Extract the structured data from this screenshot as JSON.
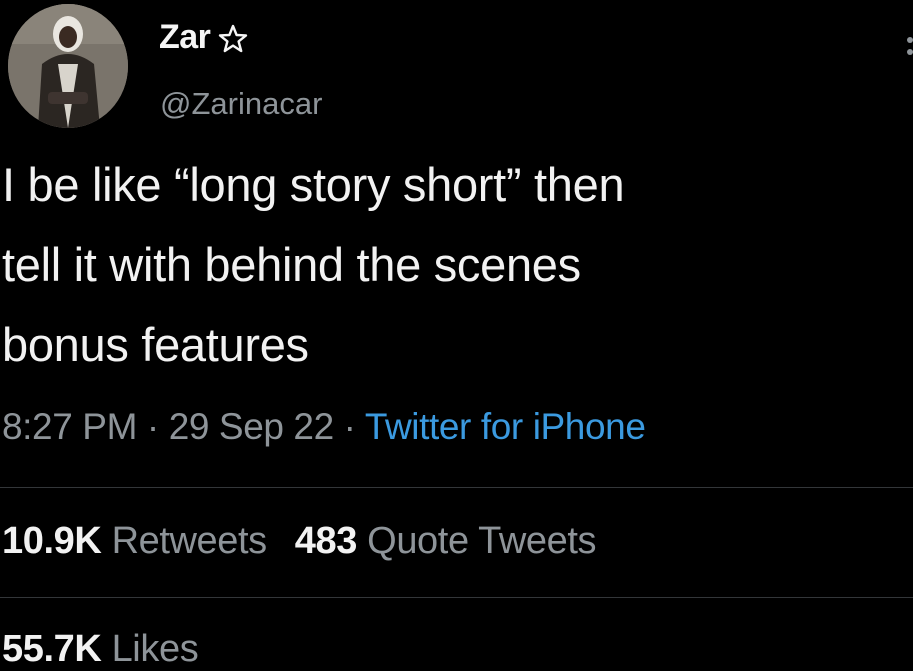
{
  "user": {
    "display_name": "Zar",
    "handle": "@Zarinacar"
  },
  "tweet": {
    "text": "I be like “long story short” then\ntell it with behind the scenes\nbonus features",
    "time": "8:27 PM",
    "separator": " · ",
    "date": "29 Sep 22",
    "source": "Twitter for iPhone"
  },
  "stats": {
    "retweets_count": "10.9K",
    "retweets_label": "Retweets",
    "quote_tweets_count": "483",
    "quote_tweets_label": "Quote Tweets",
    "likes_count": "55.7K",
    "likes_label": "Likes"
  },
  "icons": {
    "badge": "star-outline-icon",
    "menu": "more-options-icon"
  },
  "colors": {
    "background": "#000000",
    "text": "#f2f2f2",
    "secondary_text": "#8e9499",
    "link": "#3b9ae0",
    "divider": "#333639"
  }
}
